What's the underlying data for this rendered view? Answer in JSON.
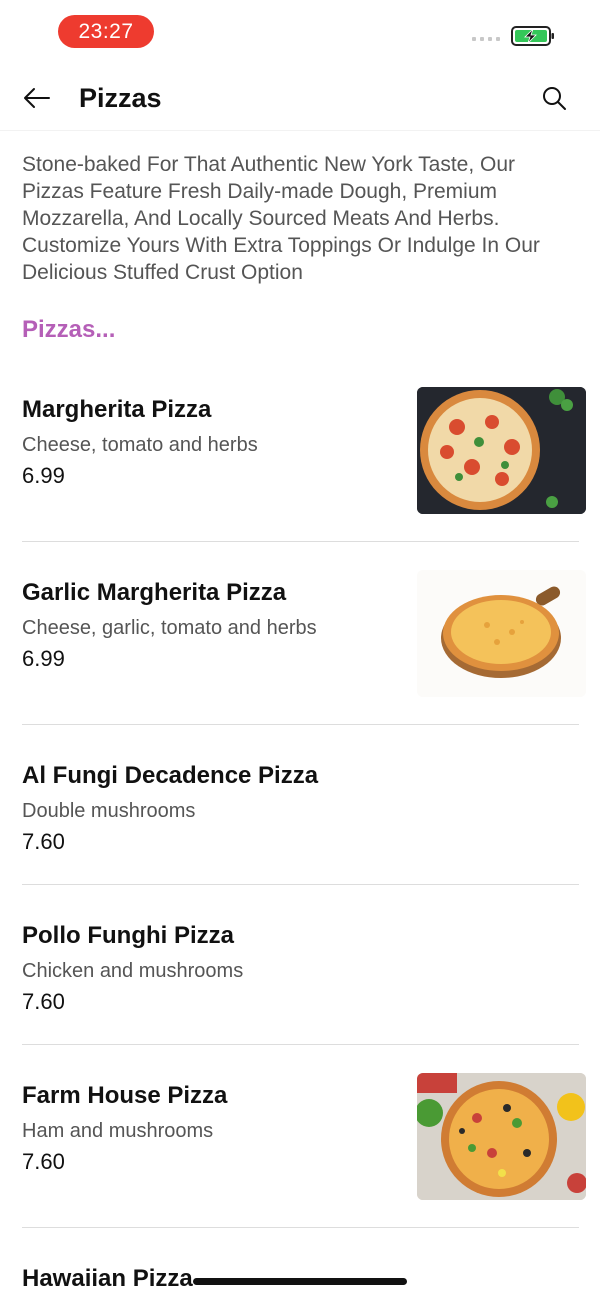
{
  "status_bar": {
    "time": "23:27",
    "time_pill_color": "#ee3b2f",
    "battery_icon": "battery-charging-icon"
  },
  "header": {
    "title": "Pizzas",
    "back_icon": "arrow-left-icon",
    "search_icon": "search-icon"
  },
  "description": "Stone-baked For That Authentic New York Taste, Our Pizzas Feature Fresh Daily-made Dough, Premium Mozzarella, And Locally Sourced Meats And Herbs. Customize Yours With Extra Toppings Or Indulge In Our Delicious Stuffed Crust Option",
  "section_title": "Pizzas...",
  "accent_color": "#b55fb7",
  "items": [
    {
      "name": "Margherita Pizza",
      "description": "Cheese, tomato and herbs",
      "price": "6.99",
      "has_image": true
    },
    {
      "name": "Garlic Margherita Pizza",
      "description": "Cheese, garlic, tomato and herbs",
      "price": "6.99",
      "has_image": true
    },
    {
      "name": "Al Fungi Decadence Pizza",
      "description": "Double mushrooms",
      "price": "7.60",
      "has_image": false
    },
    {
      "name": "Pollo Funghi Pizza",
      "description": "Chicken and mushrooms",
      "price": "7.60",
      "has_image": false
    },
    {
      "name": "Farm House Pizza",
      "description": "Ham and mushrooms",
      "price": "7.60",
      "has_image": true
    },
    {
      "name": "Hawaiian Pizza",
      "description": "",
      "price": "",
      "has_image": false
    }
  ]
}
